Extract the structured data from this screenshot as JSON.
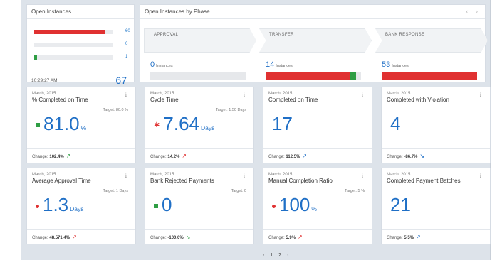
{
  "open_instances": {
    "title": "Open Instances",
    "rows": [
      {
        "count": "60",
        "fraction": 0.9,
        "color": "#e03131"
      },
      {
        "count": "0",
        "fraction": 0.0,
        "color": "#e03131"
      },
      {
        "count": "1",
        "fraction": 0.02,
        "color": "#2f9e44"
      }
    ],
    "time": "10:29:27 AM",
    "total": "67"
  },
  "phases_panel": {
    "title": "Open Instances by Phase",
    "nav": "‹ ›",
    "phases": [
      {
        "label": "APPROVAL",
        "count": "0",
        "unit": "Instances",
        "red_fraction": 0.0,
        "green_fraction": 0.0
      },
      {
        "label": "TRANSFER",
        "count": "14",
        "unit": "Instances",
        "red_fraction": 0.88,
        "green_fraction": 0.07
      },
      {
        "label": "BANK RESPONSE",
        "count": "53",
        "unit": "Instances",
        "red_fraction": 1.0,
        "green_fraction": 0.0
      }
    ]
  },
  "cards": [
    {
      "date": "March, 2015",
      "title": "% Completed on Time",
      "target": "Target: 80.0 %",
      "value": "81.0",
      "unit": "%",
      "indicator": "square",
      "change_label": "Change:",
      "change_value": "102.4%",
      "arrow": "↗",
      "arrow_class": "up-green"
    },
    {
      "date": "March, 2015",
      "title": "Cycle Time",
      "target": "Target: 1.50 Days",
      "value": "7.64",
      "unit": "Days",
      "indicator": "star",
      "change_label": "Change:",
      "change_value": "14.2%",
      "arrow": "↗",
      "arrow_class": "up-red"
    },
    {
      "date": "March, 2015",
      "title": "Completed on Time",
      "target": "",
      "value": "17",
      "unit": "",
      "indicator": "none",
      "change_label": "Change:",
      "change_value": "112.5%",
      "arrow": "↗",
      "arrow_class": "up-blue"
    },
    {
      "date": "March, 2015",
      "title": "Completed with Violation",
      "target": "",
      "value": "4",
      "unit": "",
      "indicator": "none",
      "change_label": "Change:",
      "change_value": "-86.7%",
      "arrow": "↘",
      "arrow_class": "down-blue"
    },
    {
      "date": "March, 2015",
      "title": "Average Approval Time",
      "target": "Target: 1 Days",
      "value": "1.3",
      "unit": "Days",
      "indicator": "dot",
      "change_label": "Change:",
      "change_value": "48,571.4%",
      "arrow": "↗",
      "arrow_class": "up-red"
    },
    {
      "date": "March, 2015",
      "title": "Bank Rejected Payments",
      "target": "Target: 0",
      "value": "0",
      "unit": "",
      "indicator": "square",
      "change_label": "Change:",
      "change_value": "-100.0%",
      "arrow": "↘",
      "arrow_class": "down-green"
    },
    {
      "date": "March, 2015",
      "title": "Manual Completion Ratio",
      "target": "Target: 5 %",
      "value": "100",
      "unit": "%",
      "indicator": "dot",
      "change_label": "Change:",
      "change_value": "5.9%",
      "arrow": "↗",
      "arrow_class": "up-red"
    },
    {
      "date": "March, 2015",
      "title": "Completed Payment Batches",
      "target": "",
      "value": "21",
      "unit": "",
      "indicator": "none",
      "change_label": "Change:",
      "change_value": "5.5%",
      "arrow": "↗",
      "arrow_class": "up-blue"
    }
  ],
  "info_glyph": "i",
  "pager": "‹ 1 2 ›",
  "colors": {
    "blue": "#1f6fc6",
    "red": "#e03131",
    "green": "#2f9e44",
    "bar_bg": "#e6e8eb"
  }
}
